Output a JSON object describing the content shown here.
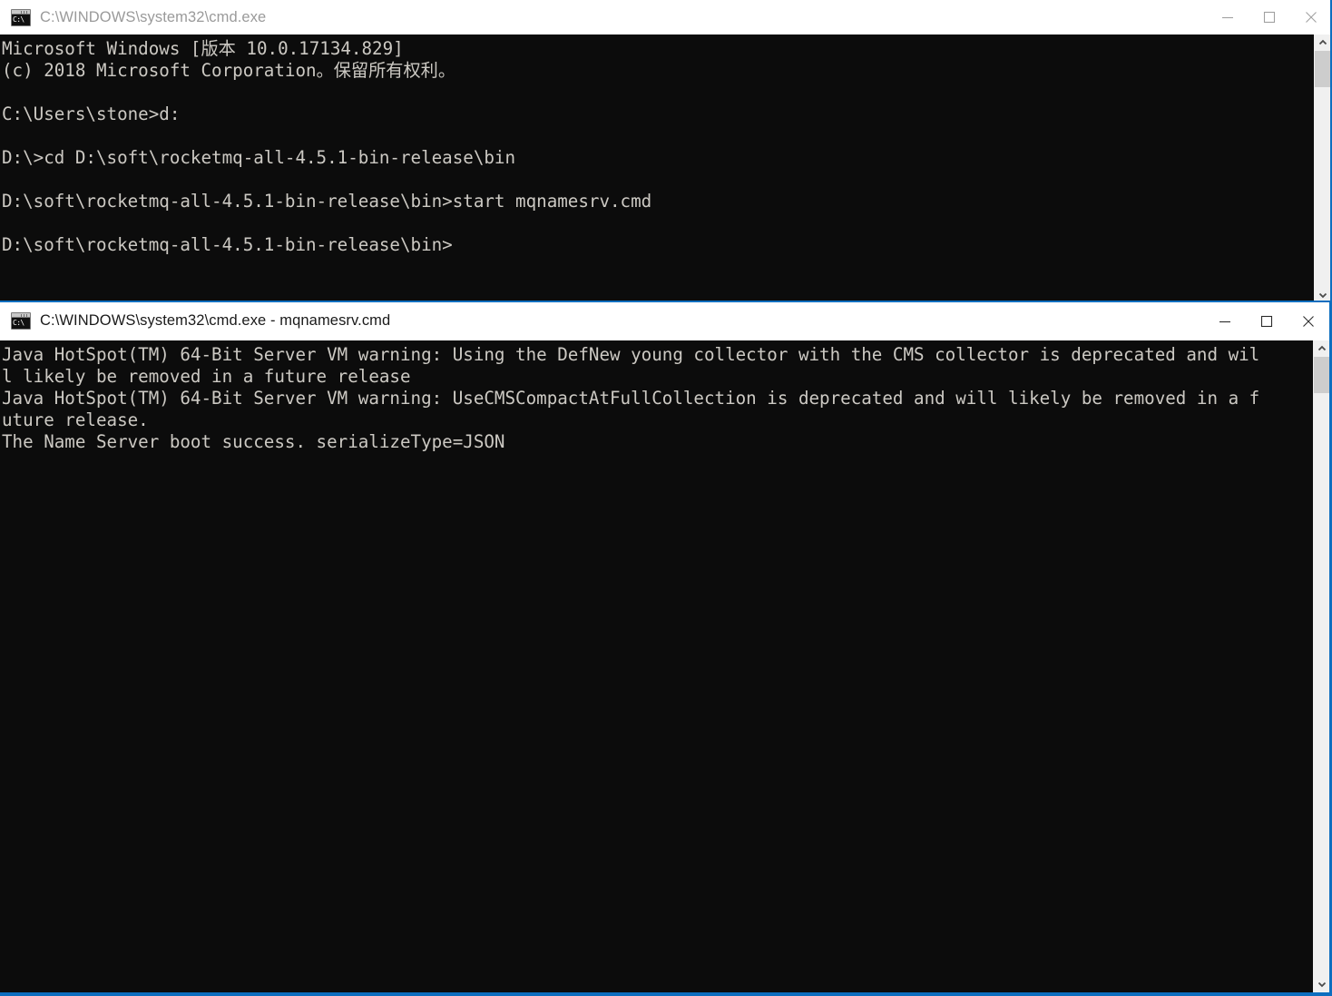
{
  "windows": [
    {
      "id": "win1",
      "title": "C:\\WINDOWS\\system32\\cmd.exe",
      "icon": "cmd-console-icon",
      "icon_prompt": "C:\\",
      "state": "inactive",
      "caption": {
        "minimize_label": "Minimize",
        "maximize_label": "Maximize",
        "close_label": "Close"
      },
      "console_text": "Microsoft Windows [版本 10.0.17134.829]\n(c) 2018 Microsoft Corporation。保留所有权利。\n\nC:\\Users\\stone>d:\n\nD:\\>cd D:\\soft\\rocketmq-all-4.5.1-bin-release\\bin\n\nD:\\soft\\rocketmq-all-4.5.1-bin-release\\bin>start mqnamesrv.cmd\n\nD:\\soft\\rocketmq-all-4.5.1-bin-release\\bin>",
      "scrollbar": {
        "up_arrow": "▲",
        "down_arrow": "▼",
        "thumb_position": "top"
      }
    },
    {
      "id": "win2",
      "title": "C:\\WINDOWS\\system32\\cmd.exe - mqnamesrv.cmd",
      "icon": "cmd-console-icon",
      "icon_prompt": "C:\\",
      "state": "active",
      "caption": {
        "minimize_label": "Minimize",
        "maximize_label": "Maximize",
        "close_label": "Close"
      },
      "console_text": "Java HotSpot(TM) 64-Bit Server VM warning: Using the DefNew young collector with the CMS collector is deprecated and wil\nl likely be removed in a future release\nJava HotSpot(TM) 64-Bit Server VM warning: UseCMSCompactAtFullCollection is deprecated and will likely be removed in a f\nuture release.\nThe Name Server boot success. serializeType=JSON",
      "scrollbar": {
        "up_arrow": "▲",
        "down_arrow": "▼",
        "thumb_position": "top"
      }
    }
  ],
  "colors": {
    "active_border": "#0d6ebf",
    "console_background": "#0c0c0c",
    "console_text": "#ccc9c3",
    "titlebar_background": "#ffffff",
    "inactive_title_text": "#9a9a9a",
    "active_title_text": "#1a1a1a",
    "scrollbar_track": "#f0f0f0",
    "scrollbar_thumb": "#cdcdcd"
  }
}
